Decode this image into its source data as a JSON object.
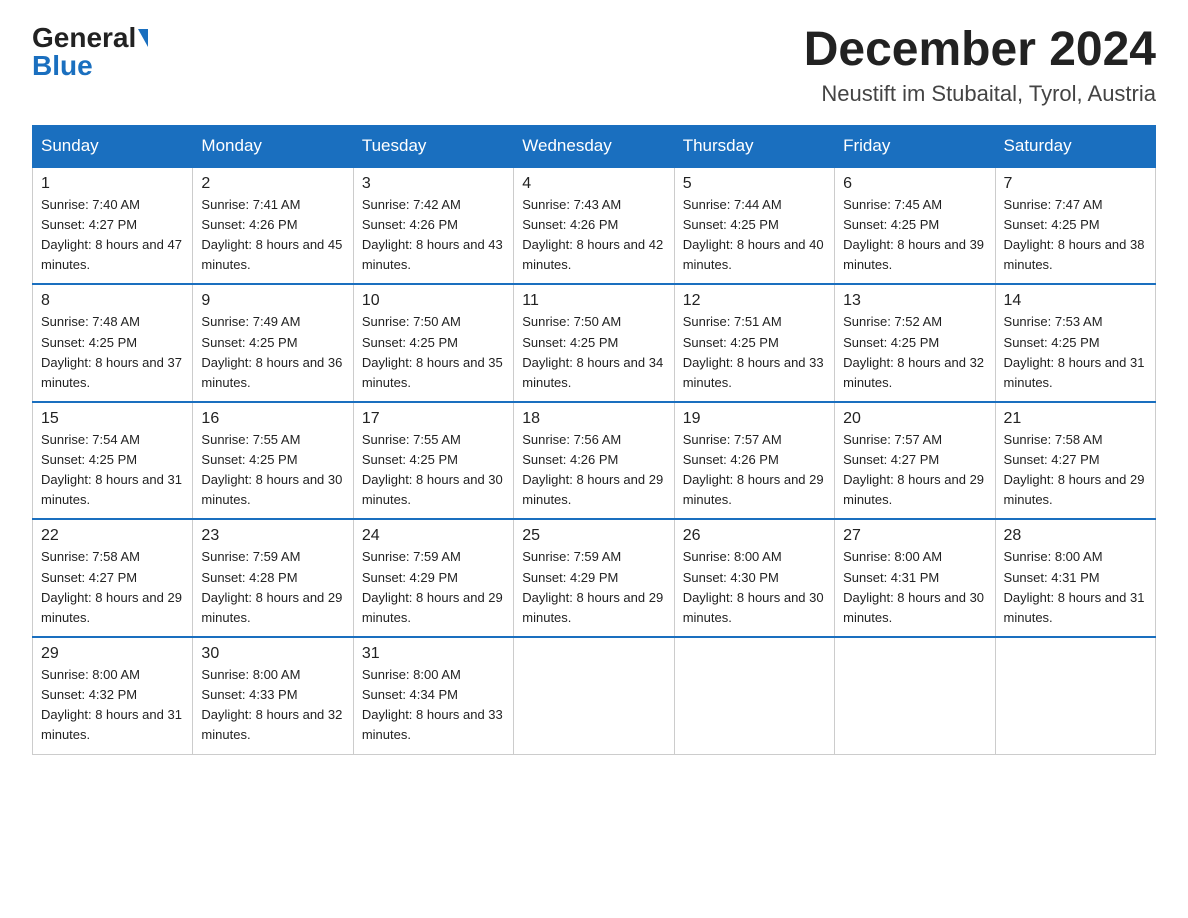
{
  "header": {
    "logo_general": "General",
    "logo_blue": "Blue",
    "month_title": "December 2024",
    "location": "Neustift im Stubaital, Tyrol, Austria"
  },
  "weekdays": [
    "Sunday",
    "Monday",
    "Tuesday",
    "Wednesday",
    "Thursday",
    "Friday",
    "Saturday"
  ],
  "weeks": [
    [
      {
        "day": "1",
        "sunrise": "7:40 AM",
        "sunset": "4:27 PM",
        "daylight": "8 hours and 47 minutes."
      },
      {
        "day": "2",
        "sunrise": "7:41 AM",
        "sunset": "4:26 PM",
        "daylight": "8 hours and 45 minutes."
      },
      {
        "day": "3",
        "sunrise": "7:42 AM",
        "sunset": "4:26 PM",
        "daylight": "8 hours and 43 minutes."
      },
      {
        "day": "4",
        "sunrise": "7:43 AM",
        "sunset": "4:26 PM",
        "daylight": "8 hours and 42 minutes."
      },
      {
        "day": "5",
        "sunrise": "7:44 AM",
        "sunset": "4:25 PM",
        "daylight": "8 hours and 40 minutes."
      },
      {
        "day": "6",
        "sunrise": "7:45 AM",
        "sunset": "4:25 PM",
        "daylight": "8 hours and 39 minutes."
      },
      {
        "day": "7",
        "sunrise": "7:47 AM",
        "sunset": "4:25 PM",
        "daylight": "8 hours and 38 minutes."
      }
    ],
    [
      {
        "day": "8",
        "sunrise": "7:48 AM",
        "sunset": "4:25 PM",
        "daylight": "8 hours and 37 minutes."
      },
      {
        "day": "9",
        "sunrise": "7:49 AM",
        "sunset": "4:25 PM",
        "daylight": "8 hours and 36 minutes."
      },
      {
        "day": "10",
        "sunrise": "7:50 AM",
        "sunset": "4:25 PM",
        "daylight": "8 hours and 35 minutes."
      },
      {
        "day": "11",
        "sunrise": "7:50 AM",
        "sunset": "4:25 PM",
        "daylight": "8 hours and 34 minutes."
      },
      {
        "day": "12",
        "sunrise": "7:51 AM",
        "sunset": "4:25 PM",
        "daylight": "8 hours and 33 minutes."
      },
      {
        "day": "13",
        "sunrise": "7:52 AM",
        "sunset": "4:25 PM",
        "daylight": "8 hours and 32 minutes."
      },
      {
        "day": "14",
        "sunrise": "7:53 AM",
        "sunset": "4:25 PM",
        "daylight": "8 hours and 31 minutes."
      }
    ],
    [
      {
        "day": "15",
        "sunrise": "7:54 AM",
        "sunset": "4:25 PM",
        "daylight": "8 hours and 31 minutes."
      },
      {
        "day": "16",
        "sunrise": "7:55 AM",
        "sunset": "4:25 PM",
        "daylight": "8 hours and 30 minutes."
      },
      {
        "day": "17",
        "sunrise": "7:55 AM",
        "sunset": "4:25 PM",
        "daylight": "8 hours and 30 minutes."
      },
      {
        "day": "18",
        "sunrise": "7:56 AM",
        "sunset": "4:26 PM",
        "daylight": "8 hours and 29 minutes."
      },
      {
        "day": "19",
        "sunrise": "7:57 AM",
        "sunset": "4:26 PM",
        "daylight": "8 hours and 29 minutes."
      },
      {
        "day": "20",
        "sunrise": "7:57 AM",
        "sunset": "4:27 PM",
        "daylight": "8 hours and 29 minutes."
      },
      {
        "day": "21",
        "sunrise": "7:58 AM",
        "sunset": "4:27 PM",
        "daylight": "8 hours and 29 minutes."
      }
    ],
    [
      {
        "day": "22",
        "sunrise": "7:58 AM",
        "sunset": "4:27 PM",
        "daylight": "8 hours and 29 minutes."
      },
      {
        "day": "23",
        "sunrise": "7:59 AM",
        "sunset": "4:28 PM",
        "daylight": "8 hours and 29 minutes."
      },
      {
        "day": "24",
        "sunrise": "7:59 AM",
        "sunset": "4:29 PM",
        "daylight": "8 hours and 29 minutes."
      },
      {
        "day": "25",
        "sunrise": "7:59 AM",
        "sunset": "4:29 PM",
        "daylight": "8 hours and 29 minutes."
      },
      {
        "day": "26",
        "sunrise": "8:00 AM",
        "sunset": "4:30 PM",
        "daylight": "8 hours and 30 minutes."
      },
      {
        "day": "27",
        "sunrise": "8:00 AM",
        "sunset": "4:31 PM",
        "daylight": "8 hours and 30 minutes."
      },
      {
        "day": "28",
        "sunrise": "8:00 AM",
        "sunset": "4:31 PM",
        "daylight": "8 hours and 31 minutes."
      }
    ],
    [
      {
        "day": "29",
        "sunrise": "8:00 AM",
        "sunset": "4:32 PM",
        "daylight": "8 hours and 31 minutes."
      },
      {
        "day": "30",
        "sunrise": "8:00 AM",
        "sunset": "4:33 PM",
        "daylight": "8 hours and 32 minutes."
      },
      {
        "day": "31",
        "sunrise": "8:00 AM",
        "sunset": "4:34 PM",
        "daylight": "8 hours and 33 minutes."
      },
      null,
      null,
      null,
      null
    ]
  ]
}
